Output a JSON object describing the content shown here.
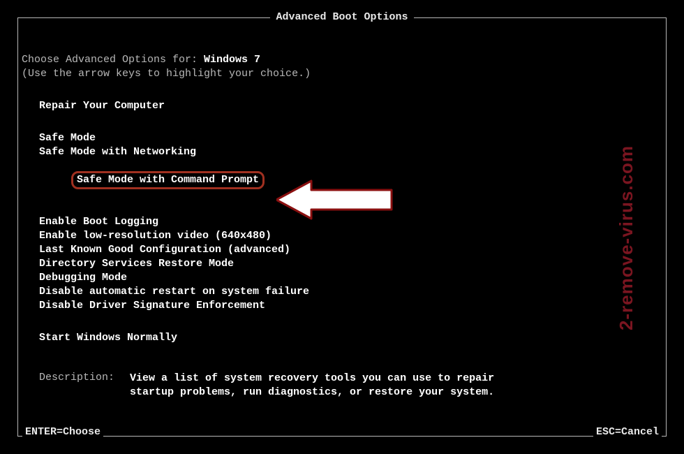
{
  "title": "Advanced Boot Options",
  "intro": {
    "prefix": "Choose Advanced Options for: ",
    "os": "Windows 7",
    "hint": "(Use the arrow keys to highlight your choice.)"
  },
  "repair": "Repair Your Computer",
  "modes": {
    "safe": "Safe Mode",
    "safe_net": "Safe Mode with Networking",
    "safe_cmd": "Safe Mode with Command Prompt"
  },
  "advanced": {
    "boot_log": "Enable Boot Logging",
    "low_res": "Enable low-resolution video (640x480)",
    "lkgc": "Last Known Good Configuration (advanced)",
    "dsrm": "Directory Services Restore Mode",
    "debug": "Debugging Mode",
    "no_auto_restart": "Disable automatic restart on system failure",
    "no_driver_sig": "Disable Driver Signature Enforcement"
  },
  "start_normal": "Start Windows Normally",
  "description": {
    "label": "Description:",
    "text": "View a list of system recovery tools you can use to repair startup problems, run diagnostics, or restore your system."
  },
  "footer": {
    "enter": "ENTER=Choose",
    "esc": "ESC=Cancel"
  },
  "watermark": "2-remove-virus.com"
}
